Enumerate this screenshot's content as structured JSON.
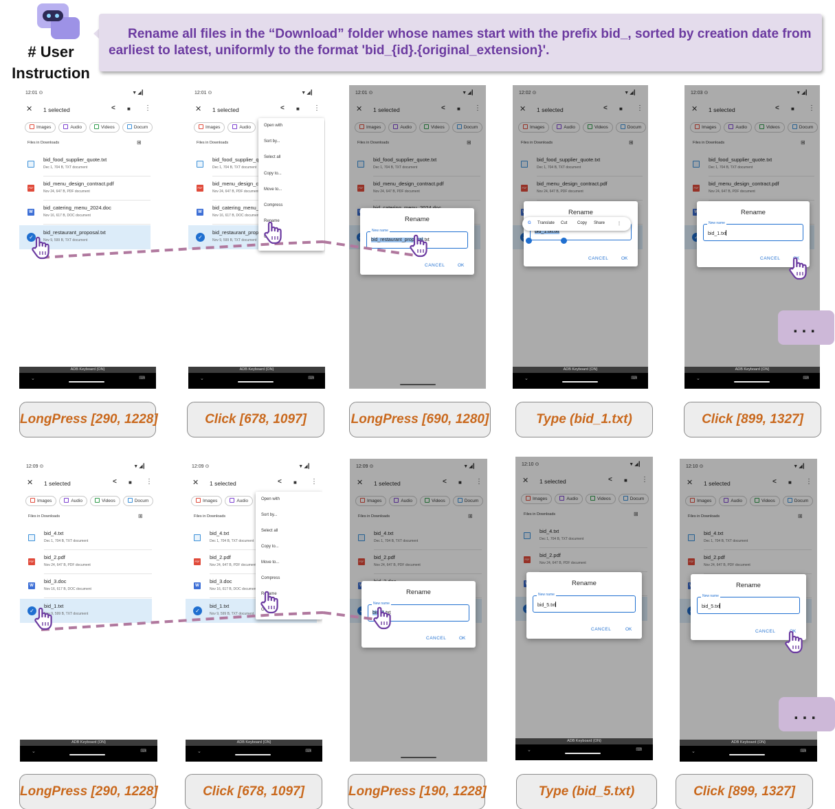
{
  "header": {
    "user_label": "# User Instruction",
    "instruction": "Rename all files in the “Download” folder whose names start with the prefix bid_, sorted by creation date from earliest to latest, uniformly to the format 'bid_{id}.{original_extension}'."
  },
  "common": {
    "selected_label": "1 selected",
    "chips": [
      "Images",
      "Audio",
      "Videos",
      "Docum"
    ],
    "section_title": "Files in Downloads",
    "keyboard_label": "ADB Keyboard {ON}",
    "menu_items": [
      "Open with",
      "Sort by...",
      "Select all",
      "Copy to...",
      "Move to...",
      "Compress",
      "Rename",
      "Get info"
    ],
    "dialog_title": "Rename",
    "field_label": "New name",
    "cancel": "CANCEL",
    "ok": "OK",
    "toolbar_items": [
      "Translate",
      "Cut",
      "Copy",
      "Share"
    ],
    "more_dots": "..."
  },
  "files_before": [
    {
      "name": "bid_food_supplier_quote.txt",
      "meta": "Dec 1, 704 B, TXT document",
      "type": "txt"
    },
    {
      "name": "bid_menu_design_contract.pdf",
      "meta": "Nov 24, 647 B, PDF document",
      "type": "pdf"
    },
    {
      "name": "bid_catering_menu_2024.doc",
      "meta": "Nov 16, 617 B, DOC document",
      "type": "doc"
    },
    {
      "name": "bid_restaurant_proposal.txt",
      "meta": "Nov 9, 599 B, TXT document",
      "type": "txt"
    }
  ],
  "files_after": [
    {
      "name": "bid_4.txt",
      "meta": "Dec 1, 704 B, TXT document",
      "type": "txt"
    },
    {
      "name": "bid_2.pdf",
      "meta": "Nov 24, 647 B, PDF document",
      "type": "pdf"
    },
    {
      "name": "bid_3.doc",
      "meta": "Nov 16, 617 B, DOC document",
      "type": "doc"
    },
    {
      "name": "bid_1.txt",
      "meta": "Nov 9, 599 B, TXT document",
      "type": "txt"
    }
  ],
  "row1": [
    {
      "time": "12:01",
      "caption": "LongPress [290, 1228]"
    },
    {
      "time": "12:01",
      "caption": "Click [678, 1097]"
    },
    {
      "time": "12:01",
      "caption": "LongPress [690, 1280]",
      "field_pre": "bid_restaurant_proposal",
      "field_post": ".txt"
    },
    {
      "time": "12:02",
      "caption": "Type (bid_1.txt)",
      "field_value": "bid_1.txt.txt"
    },
    {
      "time": "12:03",
      "caption": "Click [899, 1327]",
      "field_value": "bid_1.txt"
    }
  ],
  "row2": [
    {
      "time": "12:09",
      "caption": "LongPress [290, 1228]"
    },
    {
      "time": "12:09",
      "caption": "Click [678, 1097]"
    },
    {
      "time": "12:09",
      "caption": "LongPress [190, 1228]",
      "field_pre": "bid_1",
      "field_post": ".txt"
    },
    {
      "time": "12:10",
      "caption": "Type (bid_5.txt)",
      "field_value": "bid_5.txt"
    },
    {
      "time": "12:10",
      "caption": "Click [899, 1327]",
      "field_value": "bid_5.txt"
    }
  ],
  "colors": {
    "instruction_text": "#6b3aa0",
    "banner_bg": "#e4dcec",
    "caption_text": "#c9681c",
    "accent_blue": "#1f6fd0",
    "selected_row": "#dcecf9",
    "dashed_line": "#b0789e",
    "hand": "#6b3aa0"
  },
  "icons": [
    "robot-icon",
    "close-icon",
    "share-icon",
    "delete-icon",
    "more-vert-icon",
    "grid-view-icon",
    "checkmark-icon",
    "hand-pointer-icon",
    "google-icon"
  ]
}
